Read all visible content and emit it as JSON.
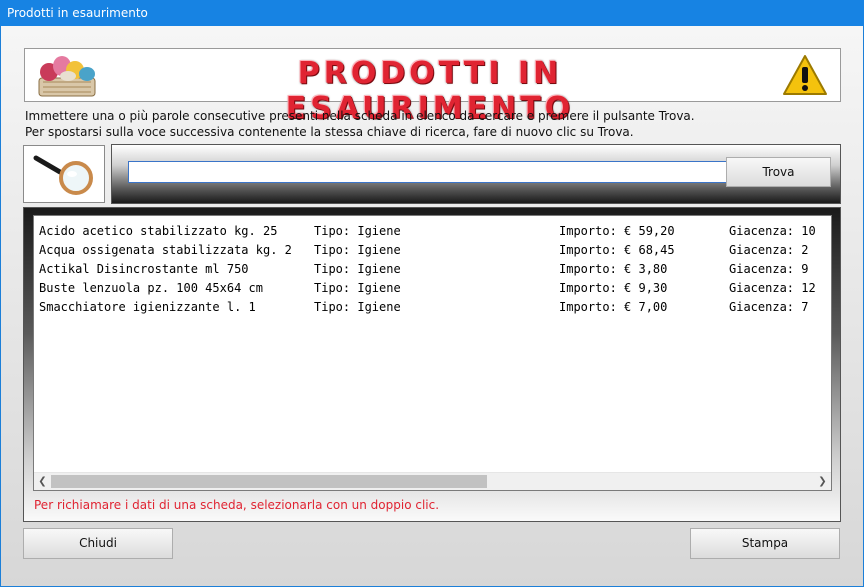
{
  "window": {
    "title": "Prodotti in esaurimento"
  },
  "banner": {
    "title": "PRODOTTI IN ESAURIMENTO",
    "left_icon": "cleaning-products-icon",
    "right_icon": "warning-icon"
  },
  "instructions": {
    "line1": "Immettere una o più parole consecutive presenti nella scheda in elenco da cercare e premere il pulsante Trova.",
    "line2": "Per spostarsi sulla voce successiva contenente la stessa chiave di ricerca, fare di nuovo clic su Trova."
  },
  "search": {
    "icon": "magnifier-icon",
    "value": "",
    "button_label": "Trova"
  },
  "list": {
    "rows": [
      {
        "name": "Acido acetico stabilizzato kg. 25",
        "tipo": "Tipo: Igiene",
        "importo": "Importo: € 59,20",
        "giacenza": "Giacenza: 10"
      },
      {
        "name": "Acqua ossigenata stabilizzata kg. 2",
        "tipo": "Tipo: Igiene",
        "importo": "Importo: € 68,45",
        "giacenza": "Giacenza: 2"
      },
      {
        "name": "Actikal Disincrostante ml 750",
        "tipo": "Tipo: Igiene",
        "importo": "Importo: € 3,80",
        "giacenza": "Giacenza: 9"
      },
      {
        "name": "Buste lenzuola pz. 100 45x64 cm",
        "tipo": "Tipo: Igiene",
        "importo": "Importo: € 9,30",
        "giacenza": "Giacenza: 12"
      },
      {
        "name": "Smacchiatore igienizzante l. 1",
        "tipo": "Tipo: Igiene",
        "importo": "Importo: € 7,00",
        "giacenza": "Giacenza: 7"
      }
    ],
    "hint": "Per richiamare i dati di una scheda, selezionarla con un doppio clic."
  },
  "buttons": {
    "close": "Chiudi",
    "print": "Stampa"
  },
  "colors": {
    "titlebar": "#1783e3",
    "accent_red": "#e02432"
  }
}
